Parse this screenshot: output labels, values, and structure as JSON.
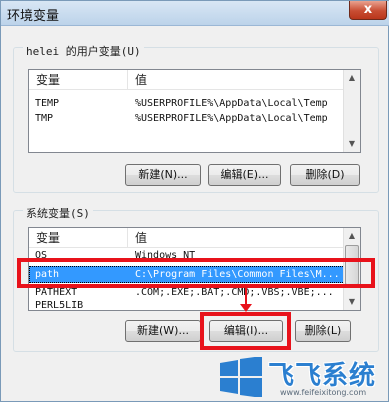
{
  "window": {
    "title": "环境变量",
    "close_glyph": "x"
  },
  "user_vars": {
    "group_label": "helei 的用户变量(U)",
    "col_variable": "变量",
    "col_value": "值",
    "rows": [
      {
        "name": "TEMP",
        "value": "%USERPROFILE%\\AppData\\Local\\Temp"
      },
      {
        "name": "TMP",
        "value": "%USERPROFILE%\\AppData\\Local\\Temp"
      }
    ],
    "buttons": {
      "new": "新建(N)...",
      "edit": "编辑(E)...",
      "delete": "删除(D)"
    }
  },
  "system_vars": {
    "group_label": "系统变量(S)",
    "col_variable": "变量",
    "col_value": "值",
    "rows": [
      {
        "name": "OS",
        "value": "Windows_NT"
      },
      {
        "name": "path",
        "value": "C:\\Program Files\\Common Files\\M..."
      },
      {
        "name": "PATHEXT",
        "value": ".COM;.EXE;.BAT;.CMD;.VBS;.VBE;..."
      },
      {
        "name": "PERL5LIB",
        "value": ""
      }
    ],
    "selected_row": "path",
    "buttons": {
      "new": "新建(W)...",
      "edit": "编辑(I)...",
      "delete": "删除(L)"
    }
  },
  "watermark": {
    "text": "飞飞系统",
    "url": "www.feifeixitong.com"
  },
  "colors": {
    "highlight": "#e8121b",
    "selection": "#3399ff",
    "brand": "#2b7fd0"
  }
}
